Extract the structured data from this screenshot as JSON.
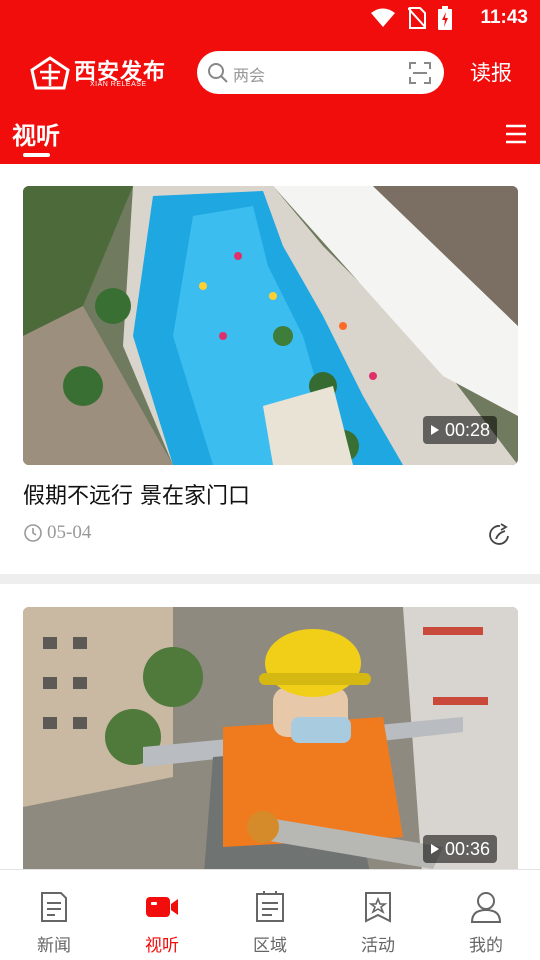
{
  "status_bar": {
    "time": "11:43",
    "icons": [
      "wifi-icon",
      "no-sim-icon",
      "battery-charging-icon"
    ]
  },
  "header": {
    "logo_cn": "西安发布",
    "logo_en": "XIAN RELEASE",
    "search_placeholder": "两会",
    "read_paper_label": "读报"
  },
  "tab": {
    "active_label": "视听"
  },
  "videos": [
    {
      "title": "假期不远行  景在家门口",
      "date": "05-04",
      "duration": "00:28"
    },
    {
      "title": "",
      "date": "",
      "duration": "00:36"
    }
  ],
  "bottom_nav": [
    {
      "label": "新闻",
      "icon": "news-icon",
      "active": false
    },
    {
      "label": "视听",
      "icon": "video-icon",
      "active": true
    },
    {
      "label": "区域",
      "icon": "region-icon",
      "active": false
    },
    {
      "label": "活动",
      "icon": "activity-icon",
      "active": false
    },
    {
      "label": "我的",
      "icon": "profile-icon",
      "active": false
    }
  ],
  "colors": {
    "brand_red": "#f20d0d",
    "active_nav": "#f20d0d",
    "inactive_nav": "#666666"
  }
}
